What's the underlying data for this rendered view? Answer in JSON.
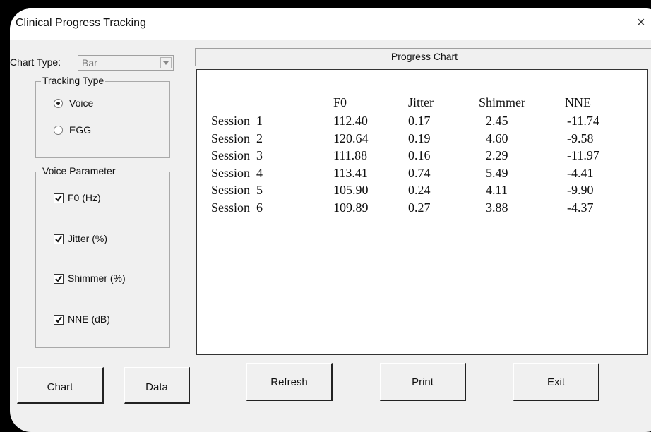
{
  "window": {
    "title": "Clinical Progress Tracking",
    "close_glyph": "×"
  },
  "chart_type": {
    "label": "Chart Type:",
    "value": "Bar"
  },
  "tracking_type": {
    "label": "Tracking Type",
    "options": [
      {
        "label": "Voice",
        "selected": true
      },
      {
        "label": "EGG",
        "selected": false
      }
    ]
  },
  "voice_parameter": {
    "label": "Voice Parameter",
    "items": [
      {
        "label": "F0 (Hz)",
        "checked": true
      },
      {
        "label": "Jitter (%)",
        "checked": true
      },
      {
        "label": "Shimmer (%)",
        "checked": true
      },
      {
        "label": "NNE (dB)",
        "checked": true
      }
    ]
  },
  "progress_chart": {
    "title": "Progress Chart",
    "columns": [
      "F0",
      "Jitter",
      "Shimmer",
      "NNE"
    ],
    "rows": [
      {
        "session": "Session  1",
        "values": [
          "112.40",
          "0.17",
          "2.45",
          "-11.74"
        ]
      },
      {
        "session": "Session  2",
        "values": [
          "120.64",
          "0.19",
          "4.60",
          "-9.58"
        ]
      },
      {
        "session": "Session  3",
        "values": [
          "111.88",
          "0.16",
          "2.29",
          "-11.97"
        ]
      },
      {
        "session": "Session  4",
        "values": [
          "113.41",
          "0.74",
          "5.49",
          "-4.41"
        ]
      },
      {
        "session": "Session  5",
        "values": [
          "105.90",
          "0.24",
          "4.11",
          "-9.90"
        ]
      },
      {
        "session": "Session  6",
        "values": [
          "109.89",
          "0.27",
          "3.88",
          "-4.37"
        ]
      }
    ]
  },
  "buttons": {
    "chart": "Chart",
    "data": "Data",
    "refresh": "Refresh",
    "print": "Print",
    "exit": "Exit"
  }
}
